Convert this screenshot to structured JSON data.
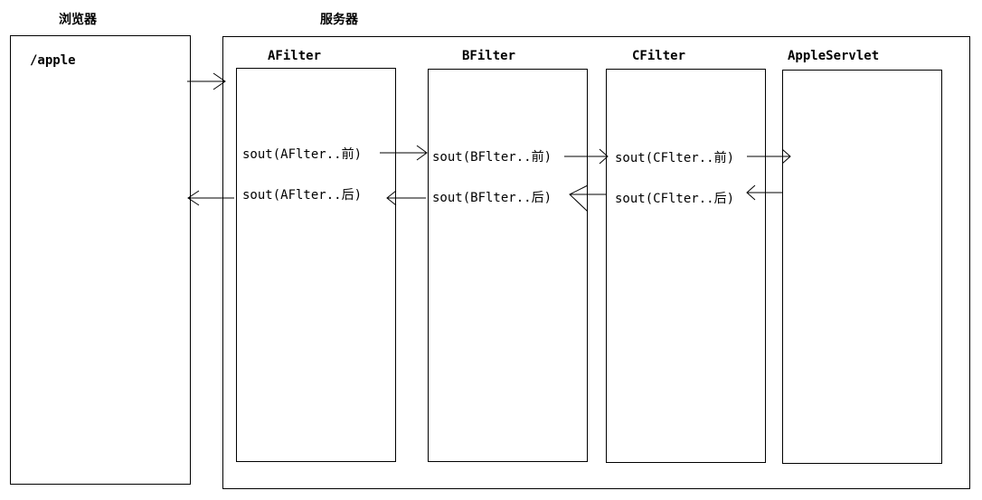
{
  "browser": {
    "title": "浏览器",
    "path": "/apple"
  },
  "server": {
    "title": "服务器",
    "components": [
      {
        "name": "AFilter",
        "before": "sout(AFlter..前)",
        "after": "sout(AFlter..后)"
      },
      {
        "name": "BFilter",
        "before": "sout(BFlter..前)",
        "after": "sout(BFlter..后)"
      },
      {
        "name": "CFilter",
        "before": "sout(CFlter..前)",
        "after": "sout(CFlter..后)"
      },
      {
        "name": "AppleServlet"
      }
    ]
  }
}
